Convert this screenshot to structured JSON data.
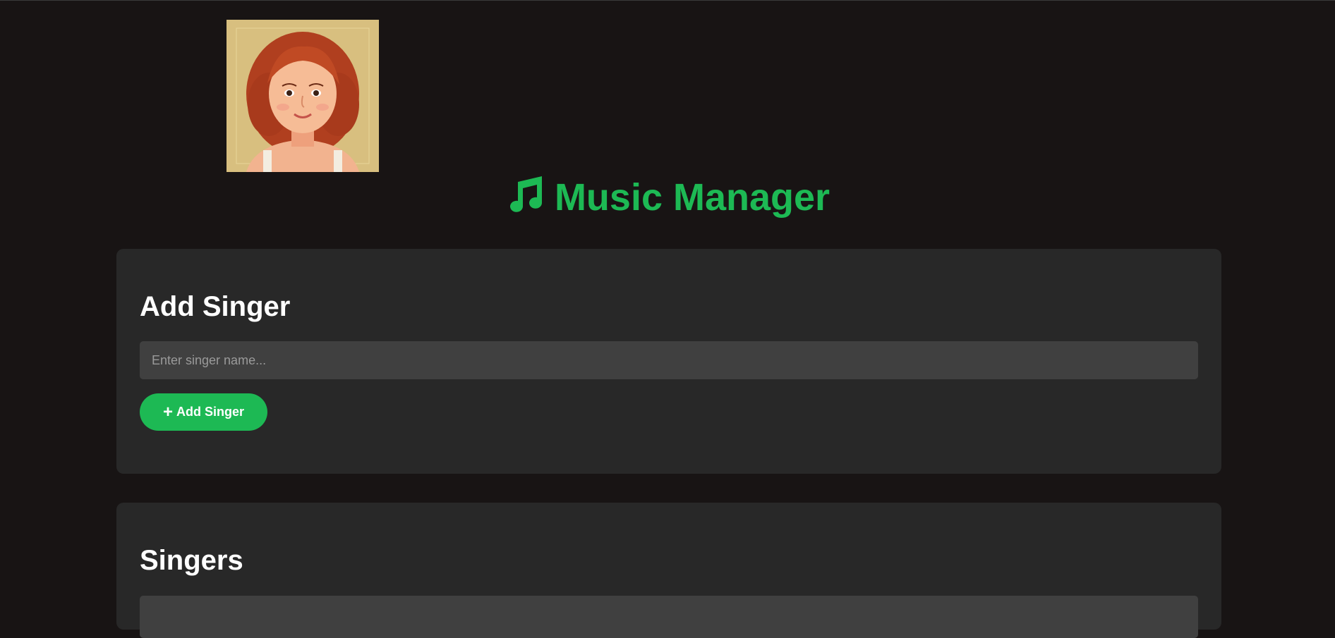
{
  "app": {
    "title": "Music Manager",
    "title_icon": "music-note-icon",
    "accent_color": "#1db954",
    "background_color": "#181414",
    "card_color": "#282828"
  },
  "avatar": {
    "description_icon": "avatar"
  },
  "add_singer": {
    "heading": "Add Singer",
    "input_placeholder": "Enter singer name...",
    "input_value": "",
    "button_label": "Add Singer",
    "button_icon": "plus-icon"
  },
  "singers": {
    "heading": "Singers"
  }
}
